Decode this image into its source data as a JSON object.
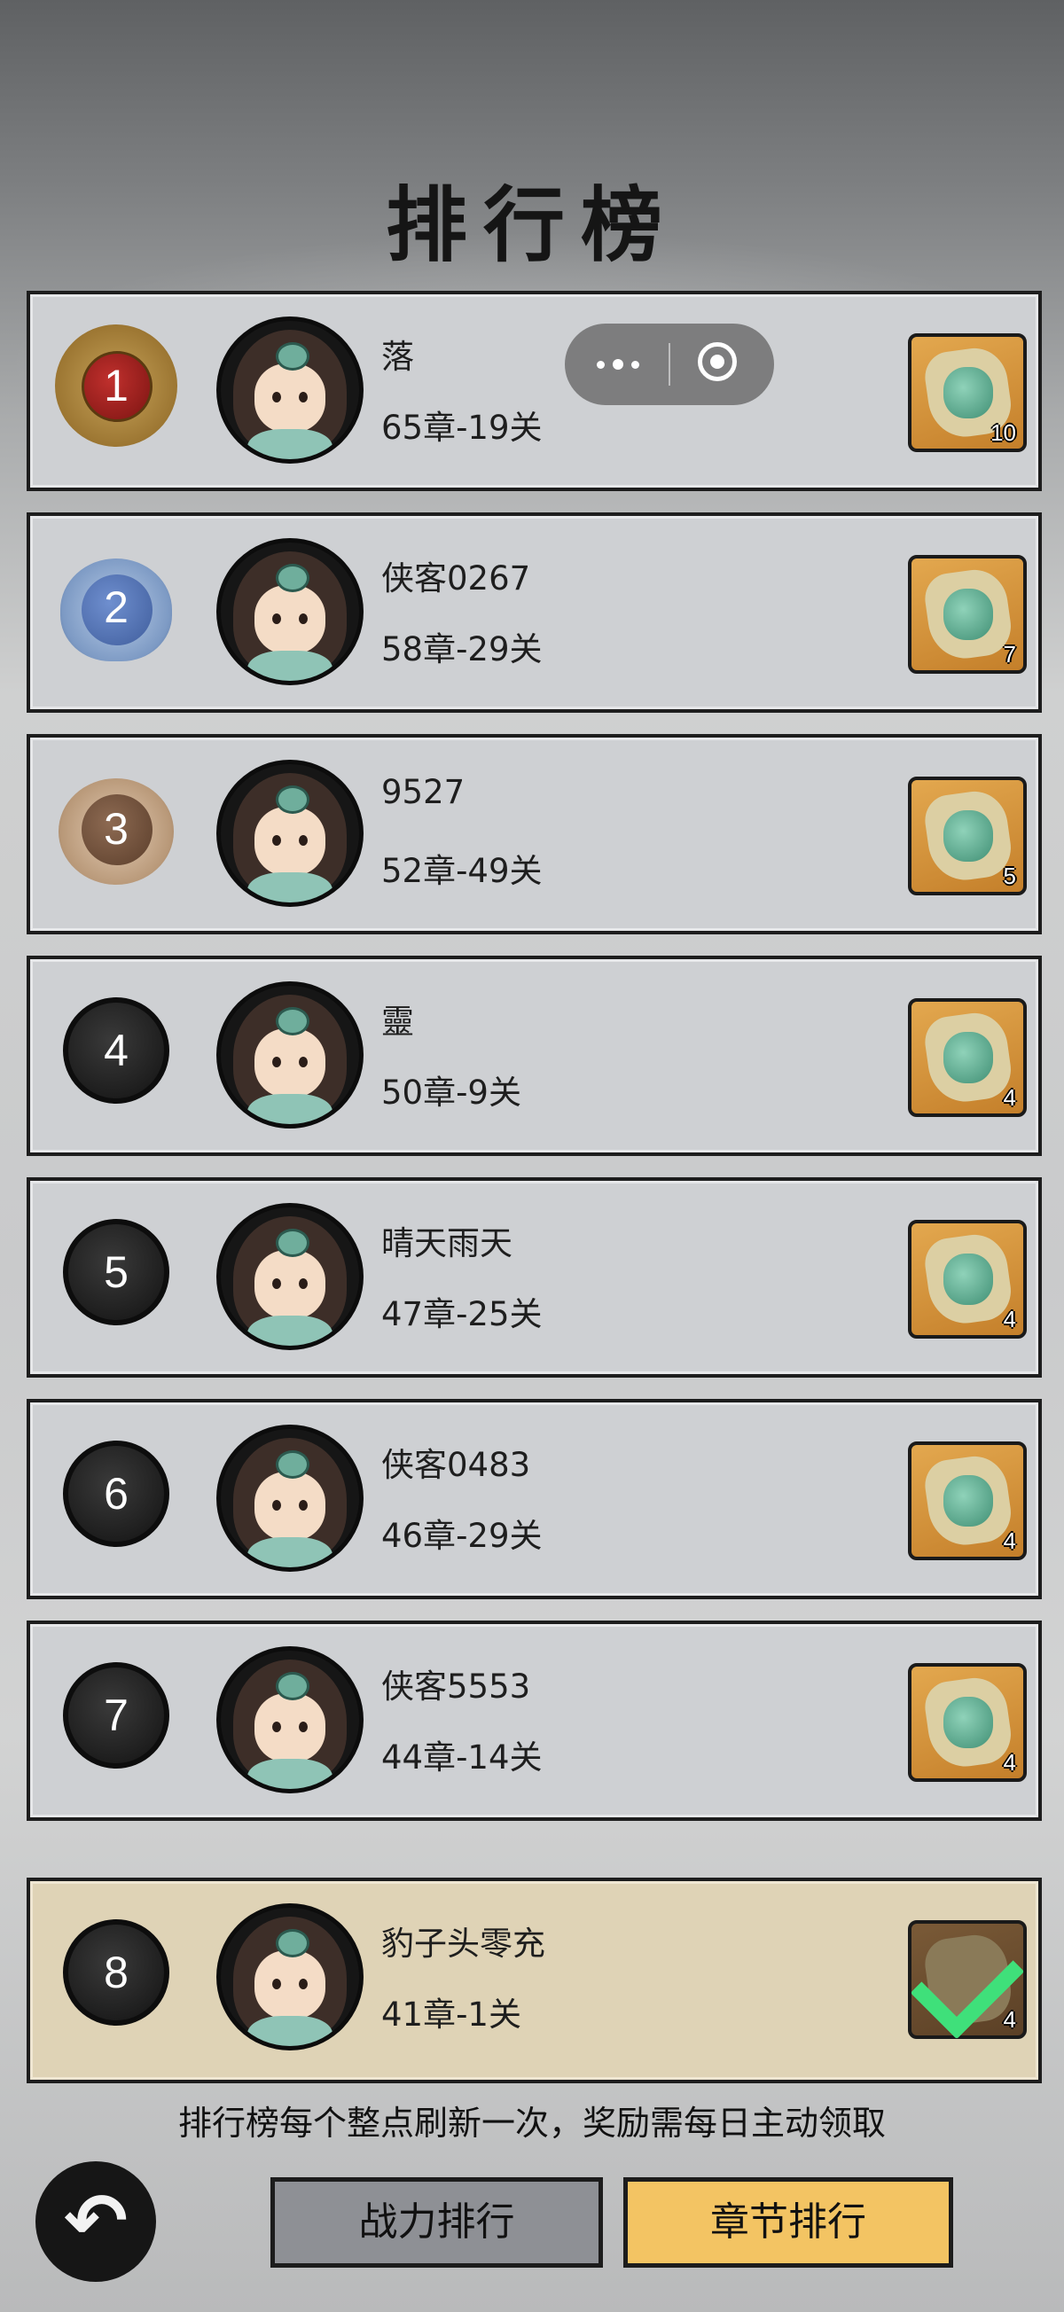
{
  "page": {
    "title": "排行榜"
  },
  "mini_capsule": {
    "more_icon": "more-dots-icon",
    "close_icon": "target-close-icon"
  },
  "rankings": [
    {
      "rank": "1",
      "name": "落",
      "progress": "65章-19关",
      "reward_count": "10",
      "badge": "gold-dragon",
      "claimed": false
    },
    {
      "rank": "2",
      "name": "侠客0267",
      "progress": "58章-29关",
      "reward_count": "7",
      "badge": "silver",
      "claimed": false
    },
    {
      "rank": "3",
      "name": "9527",
      "progress": "52章-49关",
      "reward_count": "5",
      "badge": "bronze",
      "claimed": false
    },
    {
      "rank": "4",
      "name": "靈",
      "progress": "50章-9关",
      "reward_count": "4",
      "badge": "plain",
      "claimed": false
    },
    {
      "rank": "5",
      "name": "晴天雨天",
      "progress": "47章-25关",
      "reward_count": "4",
      "badge": "plain",
      "claimed": false
    },
    {
      "rank": "6",
      "name": "侠客0483",
      "progress": "46章-29关",
      "reward_count": "4",
      "badge": "plain",
      "claimed": false
    },
    {
      "rank": "7",
      "name": "侠客5553",
      "progress": "44章-14关",
      "reward_count": "4",
      "badge": "plain",
      "claimed": false
    }
  ],
  "self": {
    "rank": "8",
    "name": "豹子头零充",
    "progress": "41章-1关",
    "reward_count": "4",
    "claimed": true
  },
  "notice": "排行榜每个整点刷新一次，奖励需每日主动领取",
  "tabs": {
    "power": "战力排行",
    "chapter": "章节排行",
    "active": "chapter"
  },
  "colors": {
    "row_bg": "#ced0d3",
    "self_row_bg": "#dfd3b6",
    "active_tab": "#f3c463",
    "inactive_tab": "#8e9095"
  }
}
